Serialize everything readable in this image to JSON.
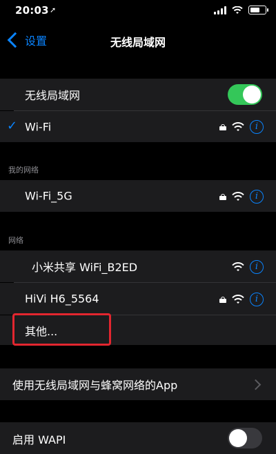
{
  "status": {
    "time": "20:03",
    "location_icon": "location-arrow-icon"
  },
  "nav": {
    "back_label": "设置",
    "title": "无线局域网"
  },
  "wifi_toggle": {
    "label": "无线局域网",
    "state": "on"
  },
  "connected": {
    "name": "Wi-Fi",
    "locked": true
  },
  "my_networks": {
    "header": "我的网络",
    "items": [
      {
        "name": "Wi-Fi_5G",
        "locked": true
      }
    ]
  },
  "networks": {
    "header": "网络",
    "items": [
      {
        "name": "小米共享 WiFi_B2ED",
        "locked": false
      },
      {
        "name": "HiVi H6_5564",
        "locked": true
      }
    ],
    "other_label": "其他..."
  },
  "apps_row": {
    "label": "使用无线局域网与蜂窝网络的App"
  },
  "wapi": {
    "label": "启用 WAPI",
    "state": "off"
  },
  "colors": {
    "accent": "#0a84ff",
    "toggle_on": "#34c759",
    "highlight": "#e3262f"
  }
}
